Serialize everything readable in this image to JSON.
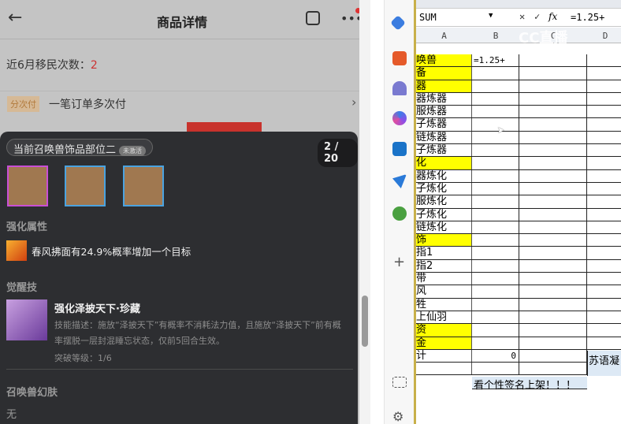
{
  "header": {
    "title": "商品详情",
    "back_icon": "←",
    "more_icon": "•••"
  },
  "migration": {
    "label": "近6月移民次数：",
    "value": "2"
  },
  "installment": {
    "tag": "分次付",
    "text": "一笔订单多次付",
    "chevron": "›"
  },
  "popup": {
    "pill_label": "当前召唤兽饰品部位二",
    "pill_badge": "未激活",
    "counter": "2 / 20",
    "enhance_title": "强化属性",
    "enhance_text": "春风拂面有24.9%概率增加一个目标",
    "awaken_title": "觉醒技",
    "skill_name": "强化泽披天下·珍藏",
    "skill_desc": "技能描述：施放“泽披天下”有概率不消耗法力值，且施放“泽披天下”前有概率摆脱一层封混睡忘状态，仅前5回合生效。",
    "skill_level": "突破等级：1/6",
    "skin_title": "召唤兽幻肤",
    "skin_value": "无"
  },
  "excel": {
    "name_box": "SUM",
    "formula": "=1.25+",
    "watermark": "CC直播",
    "columns": [
      "A",
      "B",
      "C",
      "D"
    ],
    "rows": [
      {
        "a": "唤兽",
        "y": true,
        "b": "=1.25+"
      },
      {
        "a": "备",
        "y": true
      },
      {
        "a": "器",
        "y": true
      },
      {
        "a": "器炼器"
      },
      {
        "a": "服炼器"
      },
      {
        "a": "子炼器"
      },
      {
        "a": "链炼器"
      },
      {
        "a": "子炼器"
      },
      {
        "a": "化",
        "y": true
      },
      {
        "a": "器炼化"
      },
      {
        "a": "子炼化"
      },
      {
        "a": "服炼化"
      },
      {
        "a": "子炼化"
      },
      {
        "a": "链炼化"
      },
      {
        "a": "饰",
        "y": true
      },
      {
        "a": "指1"
      },
      {
        "a": "指2"
      },
      {
        "a": "带"
      },
      {
        "a": "风"
      },
      {
        "a": "牲"
      },
      {
        "a": "上仙羽"
      },
      {
        "a": "资",
        "y": true
      },
      {
        "a": "金",
        "y": true
      },
      {
        "a": "计",
        "b": "0"
      },
      {
        "a": ""
      }
    ],
    "sig_text": "看个性签名上架！！！",
    "d_text": "苏语凝"
  }
}
